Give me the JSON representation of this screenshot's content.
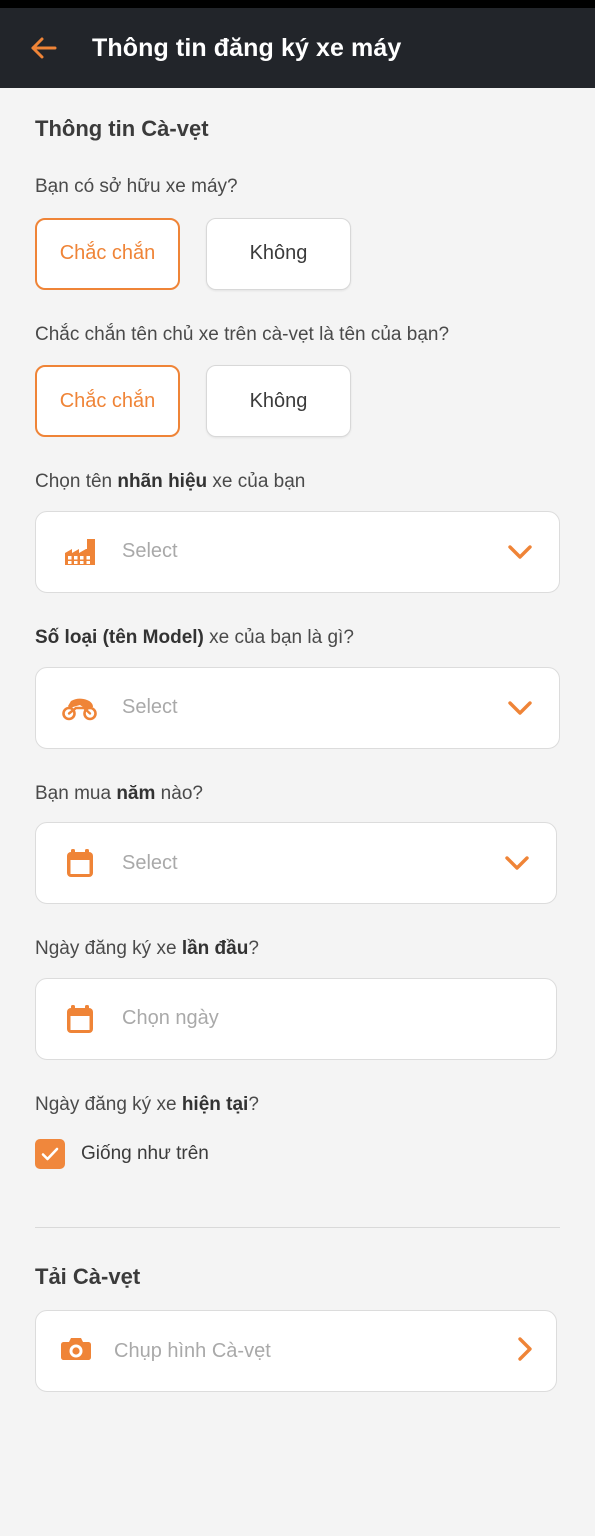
{
  "theme": {
    "accent": "#ef8437",
    "appbar_bg": "#22252a",
    "page_bg": "#f4f4f4",
    "placeholder": "#a9a9a9"
  },
  "appbar": {
    "back_icon": "arrow-left-icon",
    "title": "Thông tin đăng ký xe máy"
  },
  "section": {
    "title": "Thông tin Cà-vẹt"
  },
  "questions": [
    {
      "label": "Bạn có sở hữu xe máy?",
      "options": [
        {
          "label": "Chắc chắn",
          "selected": true
        },
        {
          "label": "Không",
          "selected": false
        }
      ]
    },
    {
      "label": "Chắc chắn tên chủ xe trên cà-vẹt là tên của bạn?",
      "options": [
        {
          "label": "Chắc chắn",
          "selected": true
        },
        {
          "label": "Không",
          "selected": false
        }
      ]
    }
  ],
  "fields": {
    "brand": {
      "label_prefix": "Chọn tên ",
      "label_bold": "nhãn hiệu",
      "label_suffix": " xe của bạn",
      "icon": "factory-icon",
      "placeholder": "Select",
      "chevron": "chevron-down-icon"
    },
    "model": {
      "label_bold": "Số loại (tên Model)",
      "label_suffix": " xe của bạn là gì?",
      "icon": "motorcycle-icon",
      "placeholder": "Select",
      "chevron": "chevron-down-icon"
    },
    "year": {
      "label_prefix": "Bạn mua ",
      "label_bold": "năm",
      "label_suffix": " nào?",
      "icon": "calendar-icon",
      "placeholder": "Select",
      "chevron": "chevron-down-icon"
    },
    "first_registration": {
      "label_prefix": "Ngày đăng ký xe ",
      "label_bold": "lần đầu",
      "label_suffix": "?",
      "icon": "calendar-icon",
      "placeholder": "Chọn ngày"
    },
    "current_registration": {
      "label_prefix": "Ngày đăng ký xe ",
      "label_bold": "hiện tại",
      "label_suffix": "?",
      "checkbox_label": "Giống như trên",
      "checkbox_checked": true,
      "check_icon": "checkmark-icon"
    }
  },
  "upload": {
    "title": "Tải Cà-vẹt",
    "icon": "camera-icon",
    "placeholder": "Chụp hình Cà-vẹt",
    "chevron": "chevron-right-icon"
  }
}
